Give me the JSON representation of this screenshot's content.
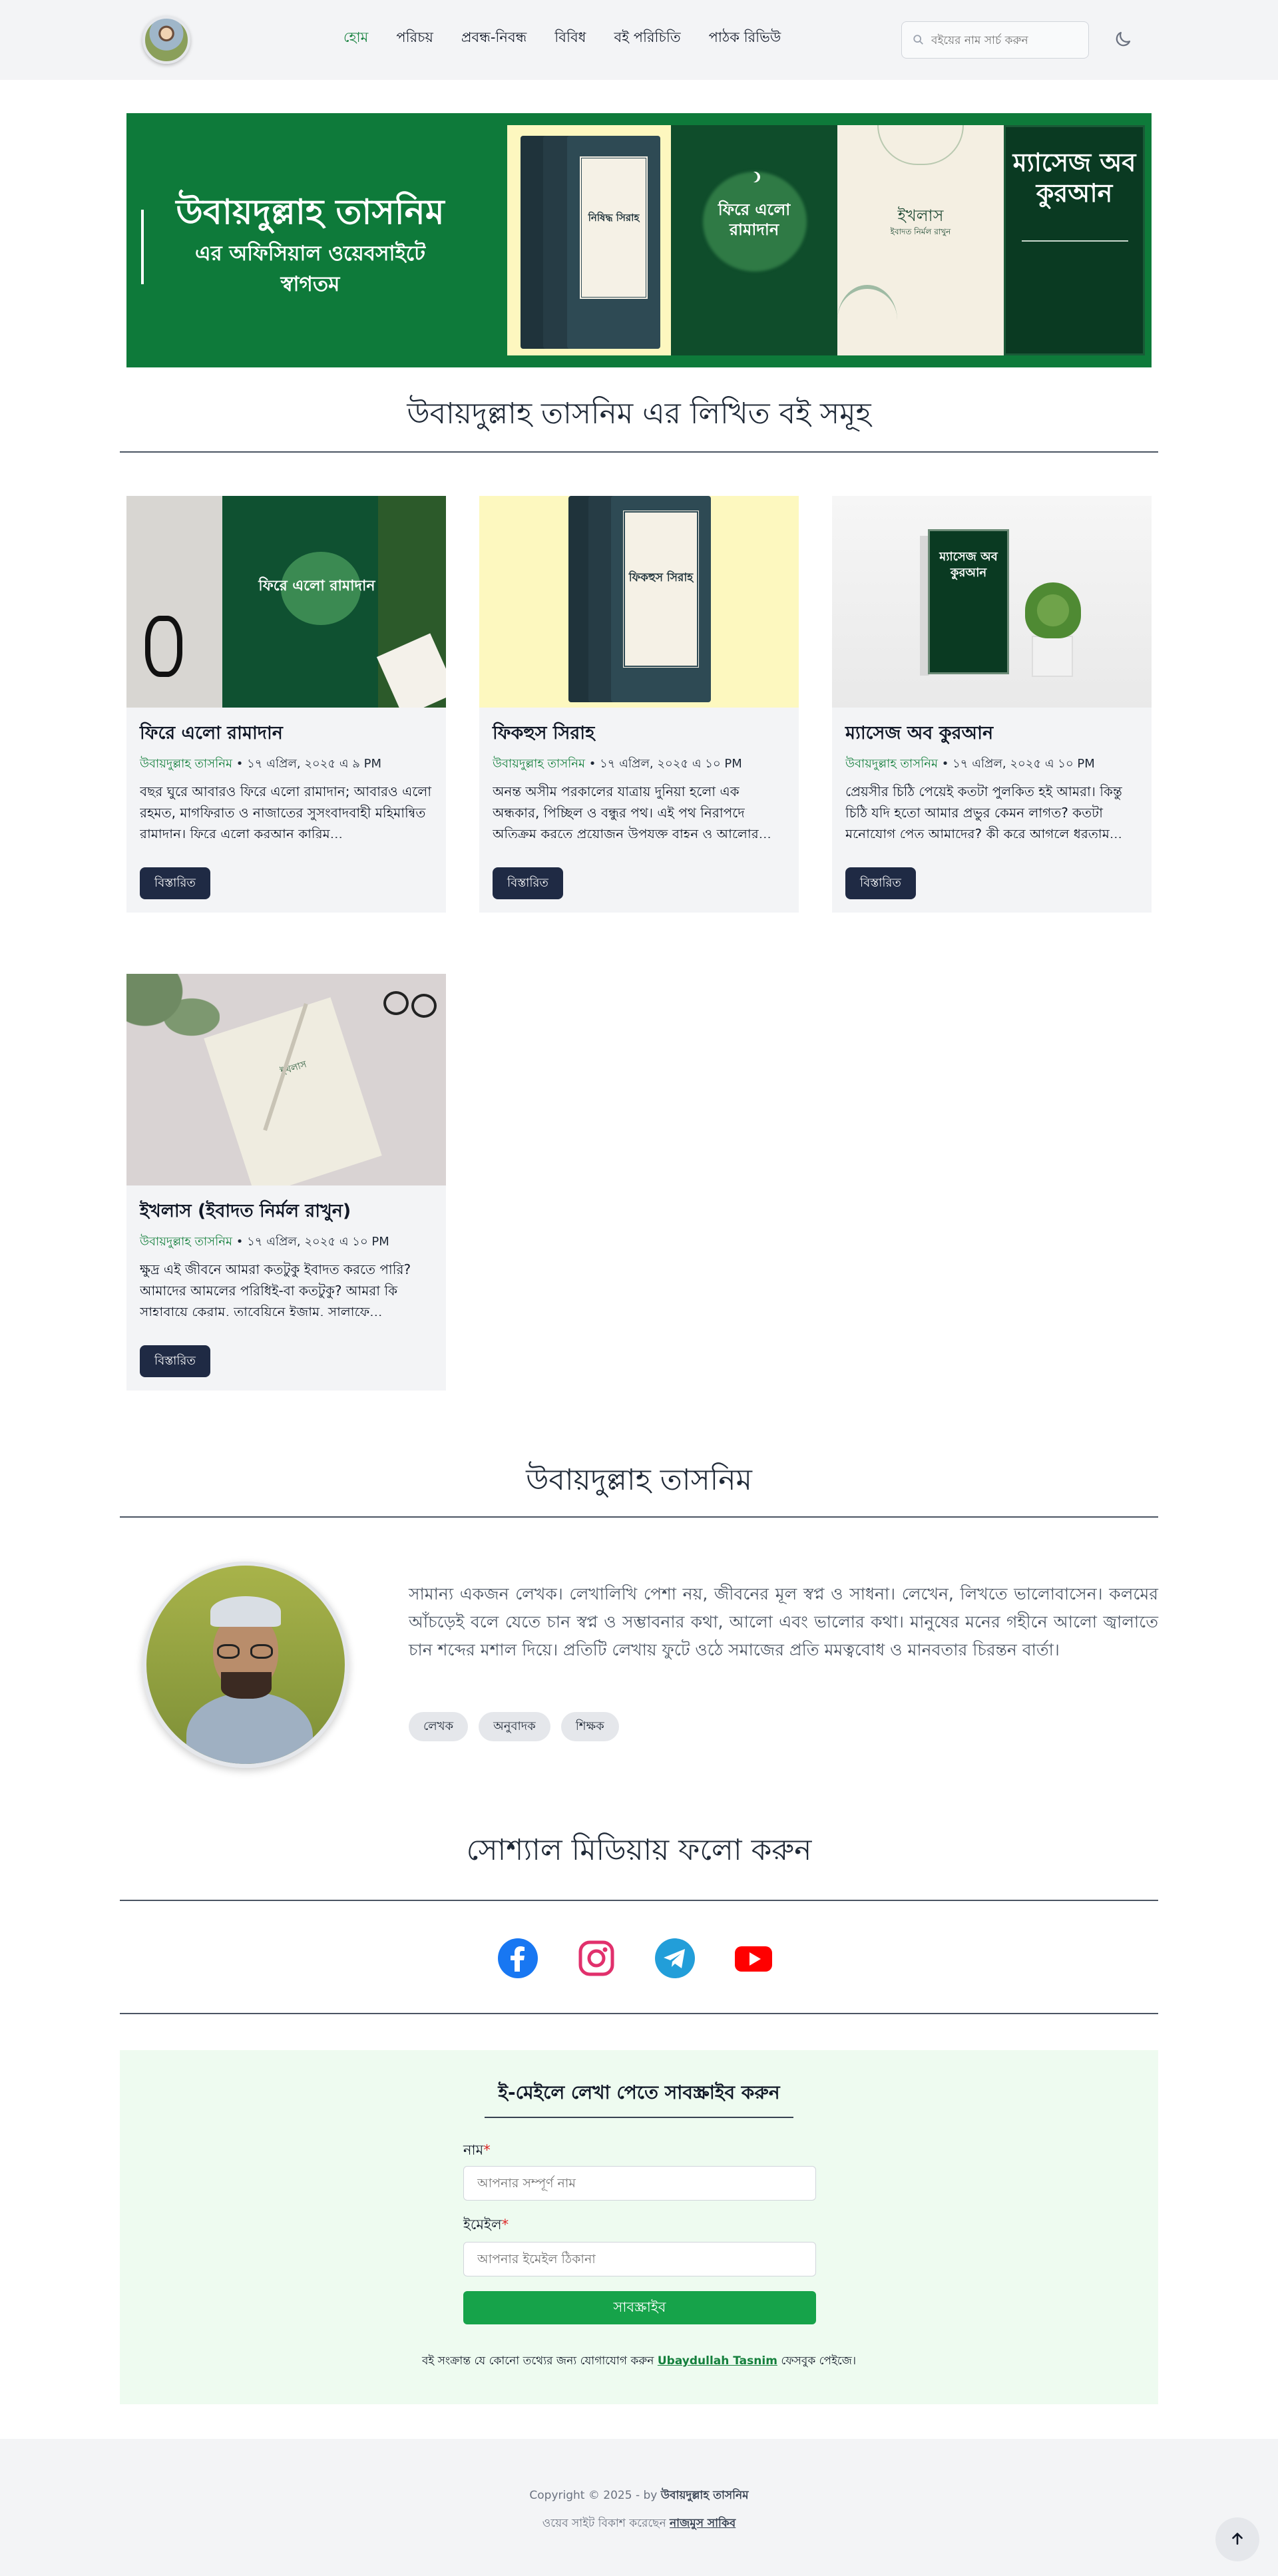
{
  "nav": {
    "items": [
      {
        "label": "হোম",
        "active": true
      },
      {
        "label": "পরিচয়"
      },
      {
        "label": "প্রবন্ধ-নিবন্ধ"
      },
      {
        "label": "বিবিধ"
      },
      {
        "label": "বই পরিচিতি"
      },
      {
        "label": "পাঠক রিভিউ"
      }
    ],
    "search_placeholder": "বইয়ের নাম সার্চ করুন",
    "theme_icon": "moon-icon"
  },
  "hero": {
    "title": "উবায়দুল্লাহ তাসনিম",
    "subtitle_line1": "এর অফিসিয়াল ওয়েবসাইটে",
    "subtitle_line2": "স্বাগতম",
    "cover1": "নিষিদ্ধ সিরাহ",
    "cover2": "ফিরে এলো রামাদান",
    "cover3": "ইখলাস",
    "cover3_sub": "ইবাদত নির্মল রাখুন",
    "cover4": "ম্যাসেজ অব কুরআন",
    "accent": "#0e7a3a"
  },
  "books_section": {
    "title": "উবায়দুল্লাহ তাসনিম এর লিখিত বই সমূহ"
  },
  "books": [
    {
      "title": "ফিরে এলো রামাদান",
      "author": "উবায়দুল্লাহ তাসনিম",
      "date": " • ১৭ এপ্রিল, ২০২৫ এ ৯ PM",
      "excerpt": "বছর ঘুরে আবারও ফিরে এলো রামাদান; আবারও এলো রহমত, মাগফিরাত ও নাজাতের সুসংবাদবাহী মহিমান্বিত রামাদান। ফিরে এলো কুরআন কারিম...",
      "button": "বিস্তারিত"
    },
    {
      "title": "ফিকহুস সিরাহ",
      "author": "উবায়দুল্লাহ তাসনিম",
      "date": " • ১৭ এপ্রিল, ২০২৫ এ ১০ PM",
      "excerpt": "অনন্ত অসীম পরকালের যাত্রায় দুনিয়া হলো এক অন্ধকার, পিচ্ছিল ও বন্ধুর পথ। এই পথ নিরাপদে অতিক্রম করতে প্রয়োজন উপযুক্ত বাহন ও আলোর...",
      "button": "বিস্তারিত"
    },
    {
      "title": "ম্যাসেজ অব কুরআন",
      "author": "উবায়দুল্লাহ তাসনিম",
      "date": " • ১৭ এপ্রিল, ২০২৫ এ ১০ PM",
      "excerpt": "প্রেয়সীর চিঠি পেয়েই কতটা পুলকিত হই আমরা। কিন্তু চিঠি যদি হতো আমার প্রভুর কেমন লাগত? কতটা মনোযোগ পেত আমাদের? কী করে আগলে ধরতাম...",
      "button": "বিস্তারিত"
    },
    {
      "title": "ইখলাস (ইবাদত নির্মল রাখুন)",
      "author": "উবায়দুল্লাহ তাসনিম",
      "date": " • ১৭ এপ্রিল, ২০২৫ এ ১০ PM",
      "excerpt": "ক্ষুদ্র এই জীবনে আমরা কতটুকু ইবাদত করতে পারি? আমাদের আমলের পরিধিই-বা কতটুকু? আমরা কি সাহাবায়ে কেরাম, তাবেয়িনে ইজাম, সালাফে...",
      "button": "বিস্তারিত"
    }
  ],
  "about": {
    "title": "উবায়দুল্লাহ তাসনিম",
    "text": "সামান্য একজন লেখক। লেখালিখি পেশা নয়, জীবনের মূল স্বপ্ন ও সাধনা। লেখেন, লিখতে ভালোবাসেন। কলমের আঁচড়েই বলে যেতে চান স্বপ্ন ও সম্ভাবনার কথা, আলো এবং ভালোর কথা। মানুষের মনের গহীনে আলো জ্বালাতে চান শব্দের মশাল দিয়ে। প্রতিটি লেখায় ফুটে ওঠে সমাজের প্রতি মমত্ববোধ ও মানবতার চিরন্তন বার্তা।",
    "tags": [
      "লেখক",
      "অনুবাদক",
      "শিক্ষক"
    ]
  },
  "social": {
    "title": "সোশ্যাল মিডিয়ায় ফলো করুন",
    "icons": [
      "facebook-icon",
      "instagram-icon",
      "telegram-icon",
      "youtube-icon"
    ],
    "colors": {
      "facebook": "#1877f2",
      "instagram": "#e1306c",
      "telegram": "#229ed9",
      "youtube": "#ff0000"
    }
  },
  "subscribe": {
    "title": "ই-মেইলে লেখা পেতে সাবস্ক্রাইব করুন",
    "name_label": "নাম",
    "name_placeholder": "আপনার সম্পূর্ণ নাম",
    "email_label": "ইমেইল",
    "email_placeholder": "আপনার ইমেইল ঠিকানা",
    "required_mark": "*",
    "button": "সাবস্ক্রাইব",
    "note_before": "বই সংক্রান্ত যে কোনো তথ্যের জন্য যোগাযোগ করুন ",
    "note_link": "Ubaydullah Tasnim",
    "note_after": " ফেসবুক পেইজে।"
  },
  "footer": {
    "copyright": "Copyright © 2025 - by ",
    "owner": "উবায়দুল্লাহ তাসনিম",
    "dev_before": "ওয়েব সাইট বিকাশ করেছেন ",
    "developer": "নাজমুস সাকিব"
  }
}
